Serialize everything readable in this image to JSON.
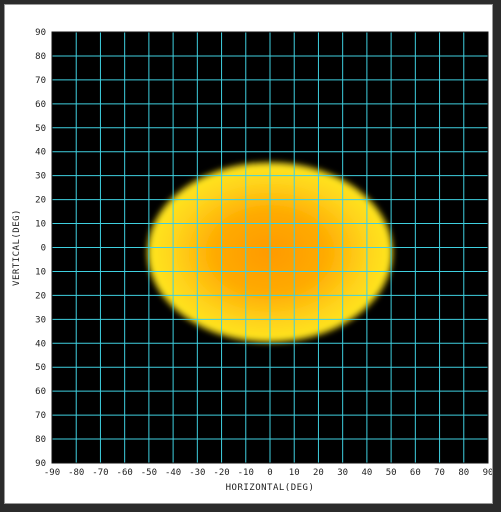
{
  "chart_data": {
    "type": "heatmap",
    "title": "",
    "xlabel": "HORIZONTAL(DEG)",
    "ylabel": "VERTICAL(DEG)",
    "xlim": [
      -90,
      90
    ],
    "ylim": [
      -90,
      90
    ],
    "x_ticks": [
      -90,
      -80,
      -70,
      -60,
      -50,
      -40,
      -30,
      -20,
      -10,
      0,
      10,
      20,
      30,
      40,
      50,
      60,
      70,
      80,
      90
    ],
    "y_ticks": [
      90,
      80,
      70,
      60,
      50,
      40,
      30,
      20,
      10,
      0,
      -10,
      -20,
      -30,
      -40,
      -50,
      -60,
      -70,
      -80,
      -90
    ],
    "x_tick_labels": [
      "-90",
      "-80",
      "-70",
      "-60",
      "-50",
      "-40",
      "-30",
      "-20",
      "-10",
      "0",
      "10",
      "20",
      "30",
      "40",
      "50",
      "60",
      "70",
      "80",
      "90"
    ],
    "y_tick_labels": [
      "90",
      "80",
      "70",
      "60",
      "50",
      "40",
      "30",
      "20",
      "10",
      "0",
      "10",
      "20",
      "30",
      "40",
      "50",
      "60",
      "70",
      "80",
      "90"
    ],
    "grid": true,
    "background_color": "#000000",
    "grid_color": "#3fd0e0",
    "spot": {
      "shape": "ellipse",
      "center": [
        0,
        -2
      ],
      "radius_h": 50,
      "radius_v": 37,
      "outer_color": "#ffe21a",
      "inner_color": "#ff9e00"
    }
  }
}
